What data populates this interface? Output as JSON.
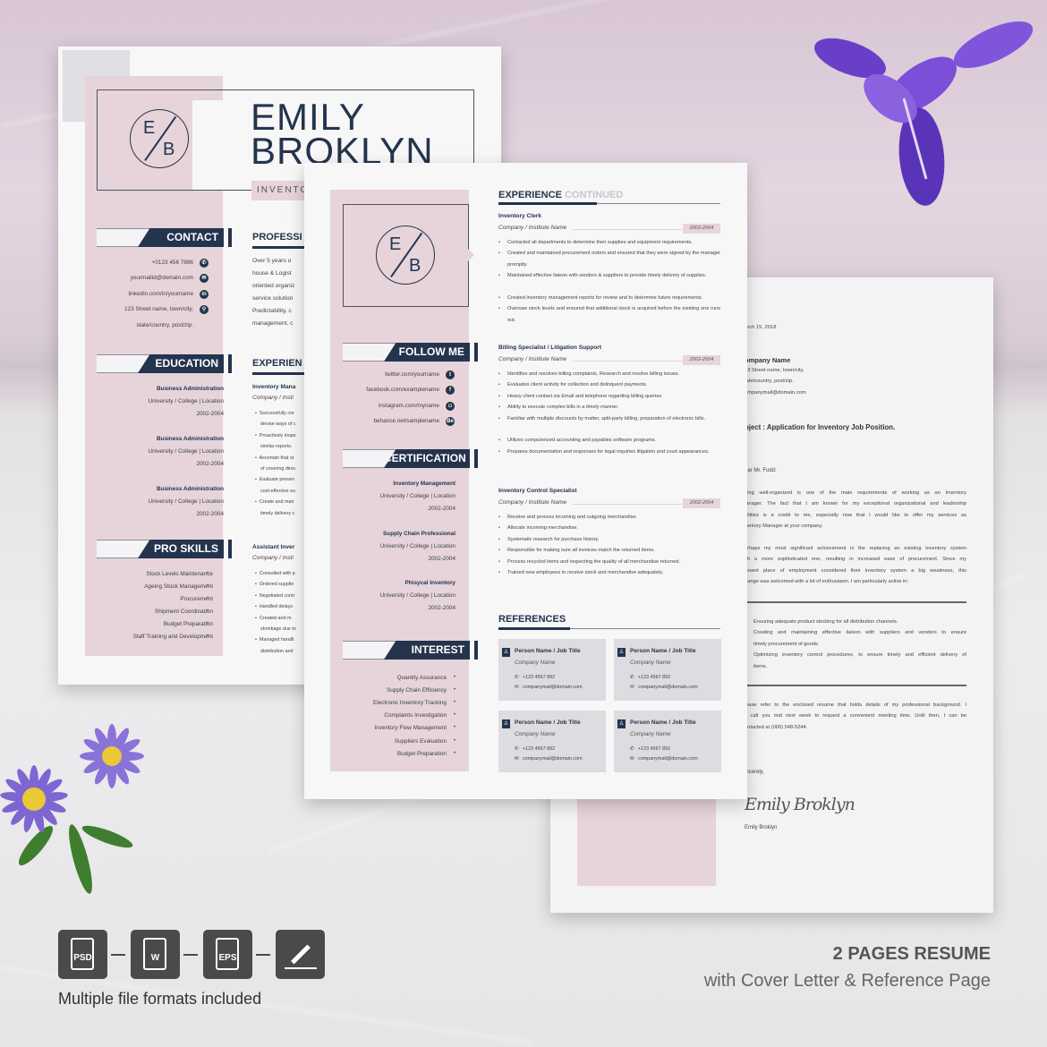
{
  "colors": {
    "navy": "#24344d",
    "pink": "#e6d4da",
    "card": "#dcdce1",
    "iris": "#6a3fc8",
    "aster": "#8b72d8"
  },
  "left_page": {
    "monogram": {
      "top": "E",
      "bottom": "B"
    },
    "name_line1": "EMILY",
    "name_line2": "BROKLYN",
    "job_title": "INVENTO",
    "contact": {
      "heading": "CONTACT",
      "items": [
        {
          "text": "+0123 456 7896",
          "icon": "phone-icon",
          "glyph": "✆"
        },
        {
          "text": "yourmailid@domain.com",
          "icon": "mail-icon",
          "glyph": "✉"
        },
        {
          "text": "linkedin.com/in/yourname",
          "icon": "linkedin-icon",
          "glyph": "in"
        },
        {
          "text": "123 Street name, town/city,",
          "icon": "location-pin-icon",
          "glyph": "⚲"
        },
        {
          "text": "state/country, post/zip.",
          "icon": "",
          "glyph": ""
        }
      ]
    },
    "education": {
      "heading": "EDUCATION",
      "entries": [
        {
          "degree": "Business Administration",
          "school": "University / College | Location",
          "years": "2002-2004"
        },
        {
          "degree": "Business Administration",
          "school": "University / College | Location",
          "years": "2002-2004"
        },
        {
          "degree": "Business Administration",
          "school": "University / College | Location",
          "years": "2002-2004"
        }
      ]
    },
    "pro_skills": {
      "heading": "PRO SKILLS",
      "items": [
        "Stock Levels Maintenance",
        "Ageing Stock Management",
        "Procurement",
        "Shipment Coordination",
        "Budget Preparation",
        "Staff Training and Development"
      ]
    },
    "profile": {
      "heading": "PROFESSI",
      "lines": [
        "Over 5 years o",
        "house & Logist",
        "oriented organiz",
        "service solution",
        "Predictability, c",
        "management, c"
      ]
    },
    "experience": {
      "heading": "EXPERIEN",
      "jobs": [
        {
          "title": "Inventory Mana",
          "company": "Company / Insti",
          "lines": [
            "•  Successfully cor",
            "    devise ways of c",
            "•  Proactively inspe",
            "    similar reports.",
            "•  Ascertain that st",
            "    of covering direc",
            "•  Evaluate presen",
            "    cost-effective su",
            "•  Create and mair",
            "    timely delivery c"
          ]
        },
        {
          "title": "Assistant Inver",
          "company": "Company / Insti",
          "lines": [
            "•  Consulted with p",
            "•  Ordered supplie",
            "•  Negotiated contr",
            "•  Handled delays",
            "•  Created and m",
            "    shrinkage due to",
            "•  Managed handli",
            "    distribution and"
          ]
        }
      ]
    }
  },
  "front_page": {
    "monogram": {
      "top": "E",
      "bottom": "B"
    },
    "follow": {
      "heading": "FOLLOW ME",
      "items": [
        {
          "text": "twitter.com/yourname",
          "icon": "twitter-icon",
          "glyph": "t"
        },
        {
          "text": "facebook.com/examplename",
          "icon": "facebook-icon",
          "glyph": "f"
        },
        {
          "text": "instagram.com/myname",
          "icon": "instagram-icon",
          "glyph": "◘"
        },
        {
          "text": "behance.net/samplename",
          "icon": "behance-icon",
          "glyph": "Be"
        }
      ]
    },
    "certification": {
      "heading": "CERTIFICATION",
      "entries": [
        {
          "name": "Inventory Management",
          "school": "University / College | Location",
          "years": "2002-2004"
        },
        {
          "name": "Supply Chain Professional",
          "school": "University / College | Location",
          "years": "2002-2004"
        },
        {
          "name": "Phisycal Inventory",
          "school": "University / College | Location",
          "years": "2002-2004"
        }
      ]
    },
    "interest": {
      "heading": "INTEREST",
      "items": [
        "Quantity Assurance",
        "Supply Chain Efficiency",
        "Electronic Inventory Tracking",
        "Complaints Investigation",
        "Inventory Flow Management",
        "Suppliers Evaluation",
        "Budget Preparation"
      ]
    },
    "experience": {
      "heading": "EXPERIENCE",
      "heading_suffix": "CONTINUED",
      "jobs": [
        {
          "title": "Inventory Clerk",
          "company": "Company / Institute Name",
          "years": "2002-2004",
          "bullets": [
            "Contacted all departments to determine their supplies and equipment requirements.",
            "Created and maintained procurement orders and ensured that they were signed by the manager promptly.",
            "Maintained effective liaison with vendors & suppliers to provide timely delivery of supplies.",
            "Created inventory management reports for review and to determine future requirements.",
            "Oversaw stock levels and ensured that additional stock is acquired before the existing one runs out."
          ]
        },
        {
          "title": "Billing Specialist / Litigation Support",
          "company": "Company / Institute Name",
          "years": "2002-2004",
          "bullets": [
            "Identifies and resolves billing complaints, Research and resolve billing issues.",
            "Evaluates client activity for collection and delinquent payments.",
            "Heavy client contact via Email and telephone regarding billing queries",
            "Ability to execute complex bills in a timely manner.",
            "Familiar with multiple discounts by matter, split-party billing, preparation of electronic bills.",
            "Utilizes computerized accounting and payables software programs.",
            "Prepares documentation and responses for legal inquiries litigation and court appearances."
          ]
        },
        {
          "title": "Inventory Control Specialist",
          "company": "Company / Institute Name",
          "years": "2002-2004",
          "bullets": [
            "Receive and process incoming and outgoing merchandise.",
            "Allocate incoming merchandise.",
            "Systematic research for purchase history.",
            "Responsible for making sure all invoices match the returned items.",
            "Process recycled items and inspecting the quality of all merchandise returned.",
            "Trained new employees to receive stock and merchandise adequately."
          ]
        }
      ]
    },
    "references": {
      "heading": "REFERENCES",
      "cards": [
        {
          "name": "Person Name / Job Title",
          "company": "Company Name",
          "phone": "+123 4567 892",
          "email": "companymail@domain.com"
        },
        {
          "name": "Person Name / Job Title",
          "company": "Company Name",
          "phone": "+123 4567 892",
          "email": "companymail@domain.com"
        },
        {
          "name": "Person Name / Job Title",
          "company": "Company Name",
          "phone": "+123 4567 892",
          "email": "companymail@domain.com"
        },
        {
          "name": "Person Name / Job Title",
          "company": "Company Name",
          "phone": "+123 4567 892",
          "email": "companymail@domain.com"
        }
      ]
    }
  },
  "cover_letter": {
    "date": "arch 15, 2018",
    "company": "ompany Name",
    "address": [
      "23 Street name, town/city,",
      "tate/country, post/zip.",
      "ompanymail@domain.com"
    ],
    "object": "bject : Application for Inventory Job Position.",
    "greeting": "ear Mr. Fudd:",
    "para1": [
      "eing well-organized is one of the main requirements of working as an Inventory",
      "lanager. The fact that I am known for my exceptional organizational and leadership",
      "bilities is a credit to me, especially now that I would like to offer my services as",
      "ventory Manager at your company."
    ],
    "para2": [
      "erhaps my most significant achievement is the replacing an existing inventory system",
      "ith a more sophisticated one, resulting in increased ease of procurement. Since my",
      "resent place of employment considered their inventory system a big weakness, this",
      "hange was welcomed with a lot of enthusiasm. I am particularly active in:"
    ],
    "bullets": [
      "Ensuring adequate product stocking for all distribution channels.",
      "Creating and maintaining effective liaison with suppliers and vendors to ensure",
      "timely procurement of goods.",
      "Optimizing inventory control procedures, to ensure timely and efficient delivery of",
      "items."
    ],
    "para3": [
      "lease refer to the enclosed resume that holds details of my professional background. I",
      "ll call you mid next week to request a convenient meeting time. Until then, I can be",
      "ontacted at (000) 548-5244."
    ],
    "closing": "incerely,",
    "signature": "Emily Broklyn",
    "signer": "Emily Broklyn"
  },
  "promo": {
    "formats": [
      {
        "label": "PSD",
        "icon": "psd-file-icon"
      },
      {
        "label": "W",
        "icon": "word-file-icon"
      },
      {
        "label": "EPS",
        "icon": "eps-file-icon"
      },
      {
        "label": "",
        "icon": "pen-signature-icon"
      }
    ],
    "formats_caption": "Multiple file formats included",
    "headline": "2 PAGES RESUME",
    "subheadline": "with Cover Letter & Reference Page"
  }
}
